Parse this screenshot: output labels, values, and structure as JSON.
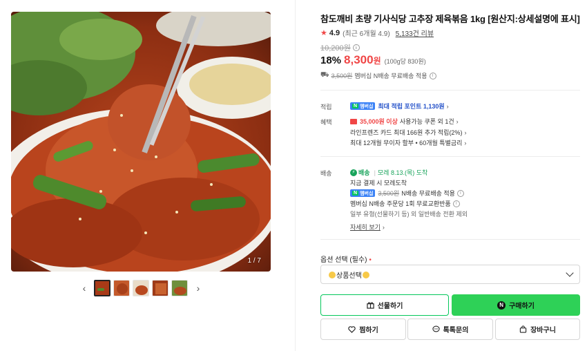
{
  "gallery": {
    "counter": "1 / 7",
    "prev_arrow": "‹",
    "next_arrow": "›",
    "thumbnail_count": 5,
    "active_thumbnail": 1
  },
  "product": {
    "title": "참도깨비 초량 기사식당 고추장 제육볶음 1kg [원산지:상세설명에 표시]",
    "rating": "4.9",
    "rating_period": "(최근 6개월 4.9)",
    "review_count": "5,133건 리뷰",
    "original_price": "10,200원",
    "discount": "18%",
    "sale_price": "8,300",
    "sale_price_unit": "원",
    "unit_price": "(100g당 830원)"
  },
  "shipping_summary": {
    "old_fee": "3,500원",
    "text": "멤버십 N배송 무료배송 적용"
  },
  "benefits": {
    "points_label": "적립",
    "points_badge": "멤버십",
    "points_text": "최대 적립 포인트 1,130원",
    "benefit_label": "혜택",
    "coupon_strong": "35,000원 이상",
    "coupon_rest": "사용가능 쿠폰 외 1건",
    "card_text": "라인프렌즈 카드 최대 166원 추가 적립(2%)",
    "installment_text": "최대 12개월 무이자 할부 • 60개월 특별금리"
  },
  "delivery": {
    "label": "배송",
    "badge": "배송",
    "date": "모레 8.13.(목) 도착",
    "pay_now": "지금 결제 시 모레도착",
    "member_badge": "멤버십",
    "old_fee": "3,500원",
    "free_text": "N배송 무료배송 적용",
    "exchange_text": "멤버십 N배송 주문당 1회 무료교환반품",
    "notice_text": "일부 유형(선물하기 등) 외 일반배송 전환 제외",
    "more_link": "자세히 보기"
  },
  "options": {
    "label": "옵션 선택 (필수)",
    "required_mark": "•",
    "selected": "상품선택"
  },
  "actions": {
    "gift": "선물하기",
    "buy": "구매하기",
    "buy_icon_letter": "N",
    "wish": "찜하기",
    "talk": "톡톡문의",
    "cart": "장바구니"
  },
  "colors": {
    "accent_red": "#f04646",
    "naver_green": "#03c75a",
    "buy_button": "#2ed157",
    "point_blue": "#2451c9"
  }
}
